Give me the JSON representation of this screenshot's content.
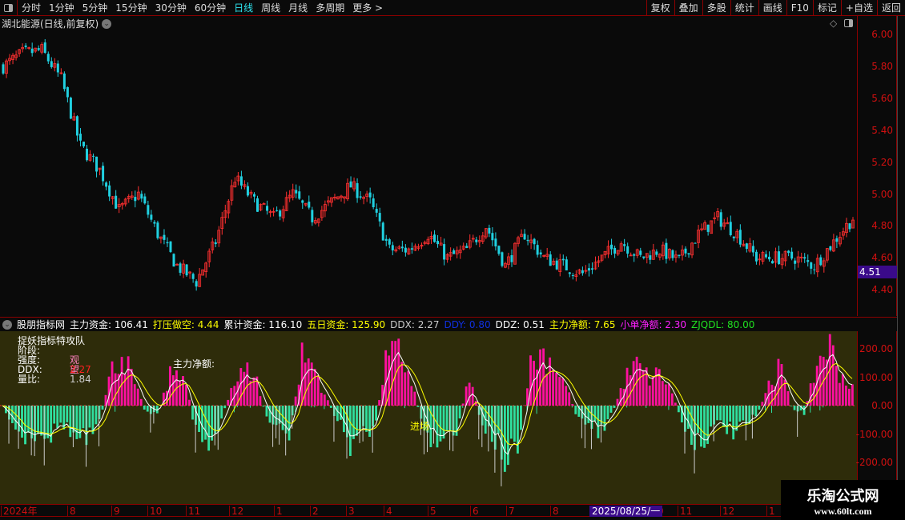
{
  "toolbar": {
    "periods": [
      "分时",
      "1分钟",
      "5分钟",
      "15分钟",
      "30分钟",
      "60分钟",
      "日线",
      "周线",
      "月线",
      "多周期",
      "更多 >"
    ],
    "active": "日线",
    "right_buttons": [
      "复权",
      "叠加",
      "多股",
      "统计",
      "画线",
      "F10",
      "标记",
      "+自选",
      "返回"
    ]
  },
  "chart": {
    "title": "湖北能源(日线,前复权)",
    "y_ticks": [
      "6.00",
      "5.80",
      "5.60",
      "5.40",
      "5.20",
      "5.00",
      "4.80",
      "4.60",
      "4.40"
    ],
    "current_price": "4.51",
    "price_trend": [
      5.8,
      5.88,
      5.9,
      5.72,
      5.3,
      5.15,
      4.9,
      5.0,
      4.75,
      4.55,
      4.45,
      4.7,
      5.1,
      4.95,
      4.85,
      5.0,
      4.85,
      4.95,
      5.05,
      4.95,
      4.65,
      4.65,
      4.75,
      4.6,
      4.65,
      4.8,
      4.55,
      4.75,
      4.6,
      4.55,
      4.5,
      4.6,
      4.7,
      4.6,
      4.65,
      4.58,
      4.75,
      4.85,
      4.75,
      4.6,
      4.6,
      4.6,
      4.55,
      4.7,
      4.85
    ],
    "up_color": "#ff3030",
    "down_color": "#20d0e0"
  },
  "indicator": {
    "header": [
      {
        "label": "股朋指标网",
        "color": "#ffffff"
      },
      {
        "label": "主力资金: 106.41",
        "color": "#ffffff"
      },
      {
        "label": "打压做空: 4.44",
        "color": "#ffff00"
      },
      {
        "label": "累计资金: 116.10",
        "color": "#ffffff"
      },
      {
        "label": "五日资金: 125.90",
        "color": "#ffff00"
      },
      {
        "label": "DDX: 2.27",
        "color": "#cccccc"
      },
      {
        "label": "DDY: 0.80",
        "color": "#1030e0"
      },
      {
        "label": "DDZ: 0.51",
        "color": "#ffffff"
      },
      {
        "label": "主力净额: 7.65",
        "color": "#ffff00"
      },
      {
        "label": "小单净额: 2.30",
        "color": "#ff20ff"
      },
      {
        "label": "ZJQDL: 80.00",
        "color": "#20e020"
      }
    ],
    "legend": {
      "title": "捉妖指标特攻队",
      "stage_label": "阶段:",
      "strength_label": "强度:",
      "strength_value": "观望",
      "ddx_label": "DDX:",
      "ddx_value": "2.27",
      "ratio_label": "量比:",
      "ratio_value": "1.84"
    },
    "annotations": {
      "net": "主力净额:",
      "entry": "进场"
    },
    "y_ticks": [
      "200.00",
      "100.00",
      "0.00",
      "-100.00",
      "-200.00"
    ],
    "flow_trend": [
      0,
      -80,
      -120,
      -90,
      -110,
      -60,
      -120,
      -130,
      -90,
      120,
      200,
      80,
      -30,
      -20,
      110,
      150,
      -70,
      -130,
      -100,
      60,
      120,
      130,
      -40,
      -90,
      -110,
      180,
      150,
      30,
      -60,
      -140,
      -110,
      -90,
      160,
      200,
      120,
      -60,
      -130,
      -110,
      -80,
      110,
      -60,
      -120,
      -200,
      -180,
      140,
      200,
      160,
      80,
      -40,
      -60,
      -100,
      -20,
      100,
      150,
      100,
      120,
      40,
      -90,
      -130,
      -110,
      -60,
      -100,
      -80,
      -40,
      80,
      140,
      -20,
      -30,
      150,
      230,
      120,
      60
    ],
    "pos_color": "#ff10a0",
    "neg_color": "#30e0a0"
  },
  "time_axis": {
    "labels": [
      "2024年",
      "8",
      "9",
      "10",
      "11",
      "12",
      "1",
      "2",
      "3",
      "4",
      "5",
      "6",
      "7",
      "8",
      "0",
      "11",
      "12",
      "1"
    ],
    "crosshair_date": "2025/08/25/一"
  },
  "watermark": {
    "name": "乐淘公式网",
    "url": "www.60lt.com"
  }
}
